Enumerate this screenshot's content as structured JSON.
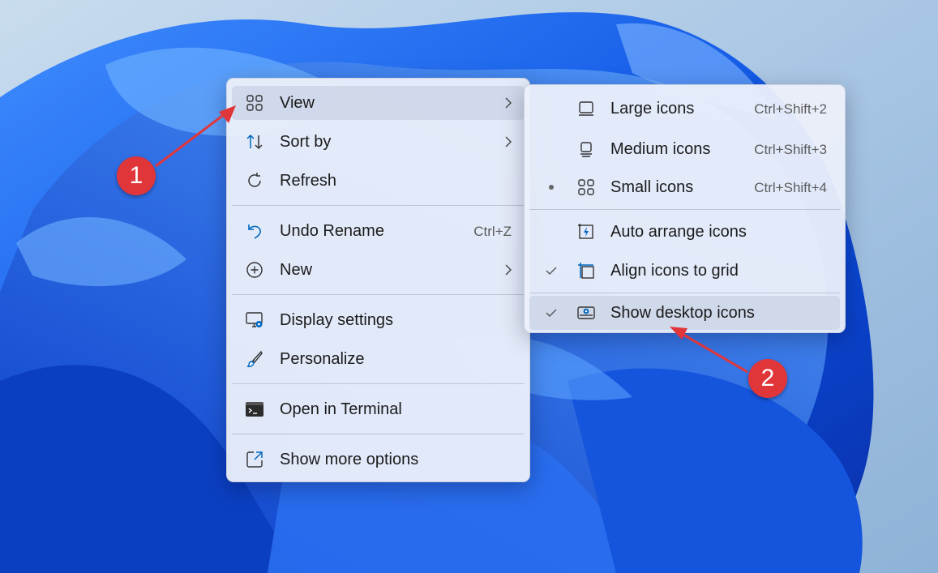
{
  "context_menu": {
    "items": [
      {
        "label": "View",
        "icon": "grid-icon",
        "submenu": true
      },
      {
        "label": "Sort by",
        "icon": "sort-icon",
        "submenu": true
      },
      {
        "label": "Refresh",
        "icon": "refresh-icon"
      },
      {
        "label": "Undo Rename",
        "icon": "undo-icon",
        "shortcut": "Ctrl+Z"
      },
      {
        "label": "New",
        "icon": "add-circle-icon",
        "submenu": true
      },
      {
        "label": "Display settings",
        "icon": "display-settings-icon"
      },
      {
        "label": "Personalize",
        "icon": "brush-icon"
      },
      {
        "label": "Open in Terminal",
        "icon": "terminal-icon"
      },
      {
        "label": "Show more options",
        "icon": "external-options-icon"
      }
    ]
  },
  "view_submenu": {
    "items": [
      {
        "label": "Large icons",
        "icon": "monitor-large-icon",
        "shortcut": "Ctrl+Shift+2"
      },
      {
        "label": "Medium icons",
        "icon": "monitor-medium-icon",
        "shortcut": "Ctrl+Shift+3"
      },
      {
        "label": "Small icons",
        "icon": "grid-small-icon",
        "shortcut": "Ctrl+Shift+4",
        "selected": "radio"
      },
      {
        "label": "Auto arrange icons",
        "icon": "auto-arrange-icon"
      },
      {
        "label": "Align icons to grid",
        "icon": "align-grid-icon",
        "selected": "check"
      },
      {
        "label": "Show desktop icons",
        "icon": "show-desktop-icon",
        "selected": "check"
      }
    ]
  },
  "annotations": [
    "1",
    "2"
  ],
  "colors": {
    "accent": "#0067c0",
    "badge": "#e0363a",
    "menu_bg": "#eef1f8"
  }
}
